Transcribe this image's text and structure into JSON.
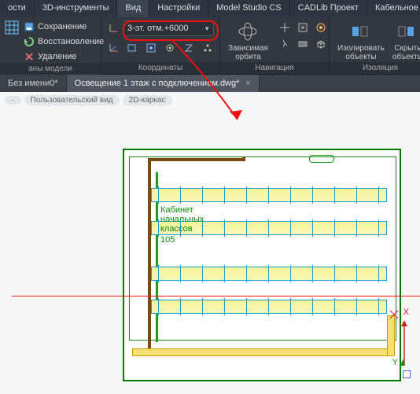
{
  "tabs": {
    "items": [
      "ости",
      "3D-инструменты",
      "Вид",
      "Настройки",
      "Model Studio CS",
      "CADLib Проект",
      "Кабельное хозяйство"
    ],
    "active_index": 2
  },
  "panel0": {
    "save": "Сохранение",
    "restore": "Восстановление",
    "delete": "Удаление",
    "label": "аны модели"
  },
  "panel1": {
    "dropdown": "3-эт. отм.+6000",
    "label": "Координаты"
  },
  "panel2": {
    "orbit": "Зависимая\nорбита",
    "label": "Навигация"
  },
  "panel3": {
    "isolate": "Изолировать\nобъекты",
    "hide": "Скрыть\nобъекты",
    "label": "Изоляция"
  },
  "doc": {
    "tab1": "Без имени0*",
    "tab2": "Освещение 1 этаж с подключением.dwg*"
  },
  "breadcrumbs": {
    "b1": "Пользовательский вид",
    "b2": "2D-каркас"
  },
  "drawing": {
    "room_name": "Кабинет\nначальных\nклассов",
    "room_num": "105",
    "axis_x": "X",
    "axis_y": "Y"
  }
}
